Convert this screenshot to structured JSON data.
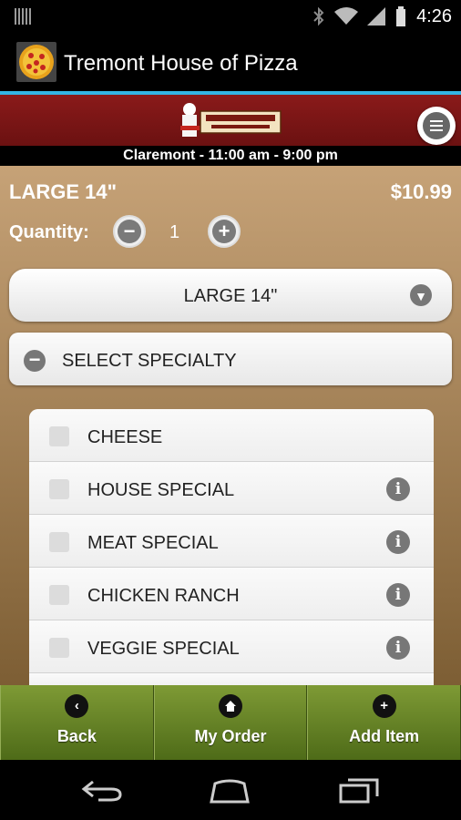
{
  "status_bar": {
    "time": "4:26"
  },
  "app": {
    "title": "Tremont House of Pizza"
  },
  "location": {
    "hours": "Claremont - 11:00 am - 9:00 pm"
  },
  "item": {
    "size_label": "LARGE 14\"",
    "price": "$10.99",
    "quantity_label": "Quantity:",
    "quantity_value": "1",
    "minus_glyph": "−",
    "plus_glyph": "+",
    "size_select_value": "LARGE 14\""
  },
  "specialty": {
    "label": "SELECT SPECIALTY",
    "options": [
      {
        "name": "CHEESE",
        "has_info": false
      },
      {
        "name": "HOUSE SPECIAL",
        "has_info": true
      },
      {
        "name": "MEAT SPECIAL",
        "has_info": true
      },
      {
        "name": "CHICKEN RANCH",
        "has_info": true
      },
      {
        "name": "VEGGIE SPECIAL",
        "has_info": true
      }
    ]
  },
  "toolbar": {
    "back_label": "Back",
    "my_order_label": "My Order",
    "add_item_label": "Add Item"
  },
  "colors": {
    "header_red": "#7a1515",
    "toolbar_green": "#6b8a2a",
    "accent_blue": "#33b5e5"
  }
}
